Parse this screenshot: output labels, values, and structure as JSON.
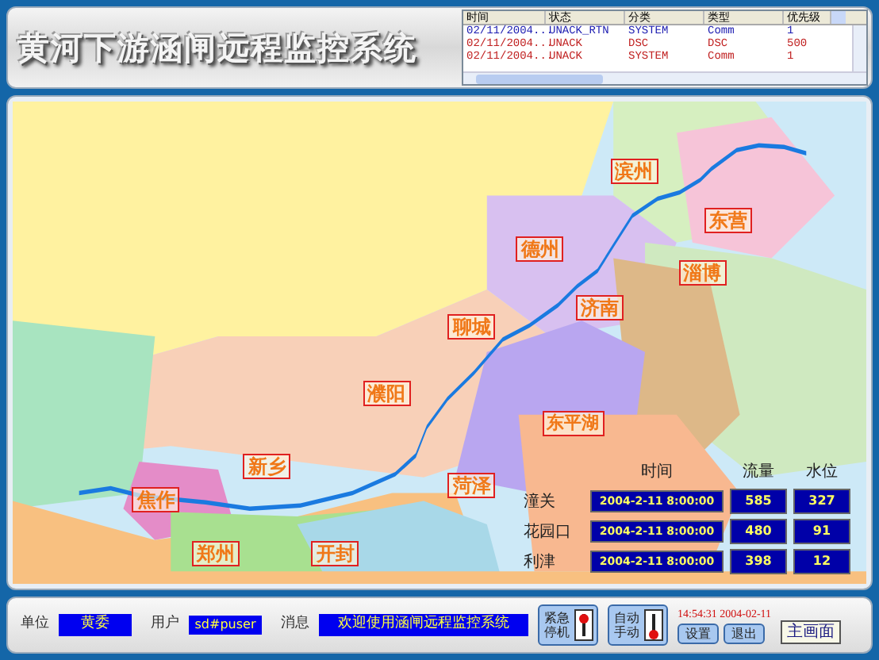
{
  "title": "黄河下游涵闸远程监控系统",
  "alarm_table": {
    "columns": [
      "时间",
      "状态",
      "分类",
      "类型",
      "优先级"
    ],
    "rows": [
      {
        "cells": [
          "02/11/2004...",
          "UNACK_RTN",
          "SYSTEM",
          "Comm",
          "1"
        ],
        "color": "#1a1ab0"
      },
      {
        "cells": [
          "02/11/2004...",
          "UNACK",
          "DSC",
          "DSC",
          "500"
        ],
        "color": "#c02020"
      },
      {
        "cells": [
          "02/11/2004...",
          "UNACK",
          "SYSTEM",
          "Comm",
          "1"
        ],
        "color": "#c02020"
      }
    ]
  },
  "map": {
    "labels": [
      "滨州",
      "东营",
      "德州",
      "淄博",
      "济南",
      "聊城",
      "濮阳",
      "东平湖",
      "新乡",
      "焦作",
      "菏泽",
      "郑州",
      "开封"
    ]
  },
  "readings": {
    "columns": [
      "时间",
      "流量",
      "水位"
    ],
    "rows": [
      {
        "station": "潼关",
        "time": "2004-2-11 8:00:00",
        "flow": "585",
        "water_level": "327"
      },
      {
        "station": "花园口",
        "time": "2004-2-11 8:00:00",
        "flow": "480",
        "water_level": "91"
      },
      {
        "station": "利津",
        "time": "2004-2-11 8:00:00",
        "flow": "398",
        "water_level": "12"
      }
    ]
  },
  "status_bar": {
    "unit_label": "单位",
    "unit": "黄委",
    "user_label": "用户",
    "user": "sd#puser",
    "message_label": "消息",
    "message": "欢迎使用涵闸远程监控系统",
    "emergency_button": "紧急停机",
    "mode_button": "自动手动",
    "clock": "14:54:31 2004-02-11",
    "settings_button": "设置",
    "exit_button": "退出",
    "main_button": "主画面"
  }
}
